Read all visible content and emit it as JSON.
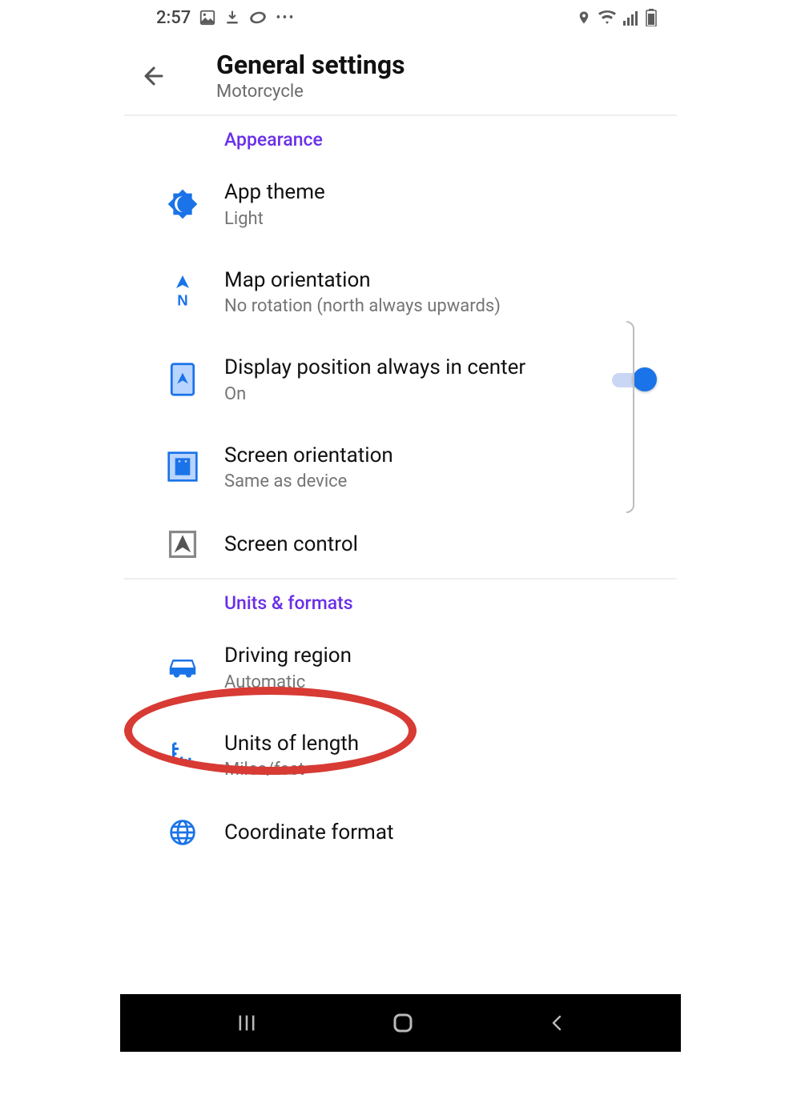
{
  "status": {
    "time": "2:57"
  },
  "header": {
    "title": "General settings",
    "subtitle": "Motorcycle"
  },
  "sections": {
    "appearance": {
      "label": "Appearance",
      "theme": {
        "title": "App theme",
        "sub": "Light"
      },
      "mapori": {
        "title": "Map orientation",
        "sub": "No rotation (north always upwards)"
      },
      "poscen": {
        "title": "Display position always in center",
        "sub": "On",
        "toggle": true
      },
      "scrori": {
        "title": "Screen orientation",
        "sub": "Same as device"
      },
      "scrctl": {
        "title": "Screen control"
      }
    },
    "units": {
      "label": "Units & formats",
      "region": {
        "title": "Driving region",
        "sub": "Automatic"
      },
      "length": {
        "title": "Units of length",
        "sub": "Miles/feet"
      },
      "coord": {
        "title": "Coordinate format"
      }
    }
  },
  "colors": {
    "accent": "#1a73e8",
    "section": "#6a2fe8",
    "highlight": "#d83a34"
  }
}
